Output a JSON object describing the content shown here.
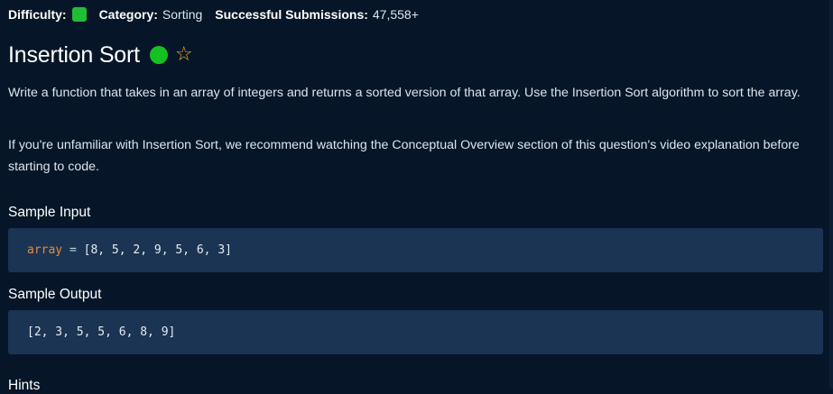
{
  "meta": {
    "difficulty_label": "Difficulty:",
    "category_label": "Category:",
    "category_value": "Sorting",
    "submissions_label": "Successful Submissions:",
    "submissions_value": "47,558+",
    "difficulty_color": "#1fbf35"
  },
  "problem": {
    "title": "Insertion Sort",
    "difficulty_dot_color": "#15c122",
    "star_icon": "star-outline-icon",
    "paragraph_1": "Write a function that takes in an array of integers and returns a sorted version of that array. Use the Insertion Sort algorithm to sort the array.",
    "paragraph_2": "If you're unfamiliar with Insertion Sort, we recommend watching the Conceptual Overview section of this question's video explanation before starting to code."
  },
  "sample_input": {
    "heading": "Sample Input",
    "var_name": "array",
    "operator": " = ",
    "value": "[8, 5, 2, 9, 5, 6, 3]"
  },
  "sample_output": {
    "heading": "Sample Output",
    "value": "[2, 3, 5, 5, 6, 8, 9]"
  },
  "hints": {
    "heading": "Hints"
  }
}
